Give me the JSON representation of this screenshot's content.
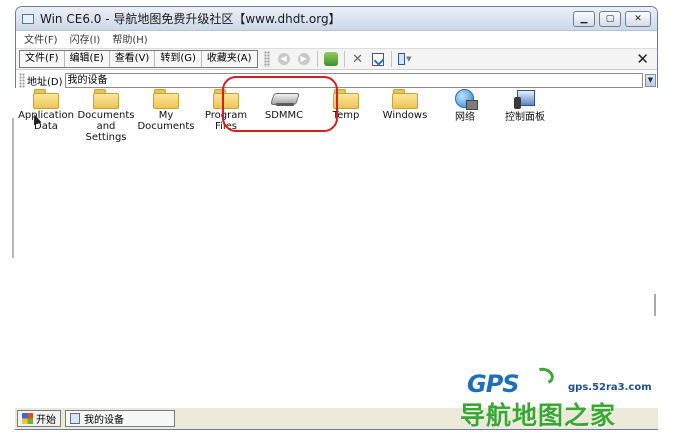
{
  "window": {
    "title": "Win CE6.0 - 导航地图免费升级社区【www.dhdt.org】"
  },
  "menubar": {
    "items": [
      "文件(F)",
      "闪存(I)",
      "帮助(H)"
    ]
  },
  "toolbar": {
    "commands": [
      "文件(F)",
      "编辑(E)",
      "查看(V)",
      "转到(G)",
      "收藏夹(A)"
    ],
    "close_label": "✕"
  },
  "addressbar": {
    "label": "地址(D)",
    "value": "我的设备"
  },
  "items": [
    {
      "label": "Application\nData",
      "icon": "folder-icon"
    },
    {
      "label": "Documents\nand Settings",
      "icon": "folder-icon"
    },
    {
      "label": "My\nDocuments",
      "icon": "folder-icon"
    },
    {
      "label": "Program Files",
      "icon": "folder-icon"
    },
    {
      "label": "SDMMC",
      "icon": "storage-card-icon"
    },
    {
      "label": "Temp",
      "icon": "folder-icon"
    },
    {
      "label": "Windows",
      "icon": "folder-icon"
    },
    {
      "label": "网络",
      "icon": "network-icon"
    },
    {
      "label": "控制面板",
      "icon": "control-panel-icon"
    }
  ],
  "taskbar": {
    "start_label": "开始",
    "task_label": "我的设备"
  },
  "watermark": {
    "logo": "GPS",
    "url": "gps.52ra3.com",
    "cn": "导航地图之家"
  },
  "colors": {
    "highlight": "#d21f1f",
    "watermark_green": "#3aa735",
    "watermark_blue": "#1f6fb8"
  }
}
